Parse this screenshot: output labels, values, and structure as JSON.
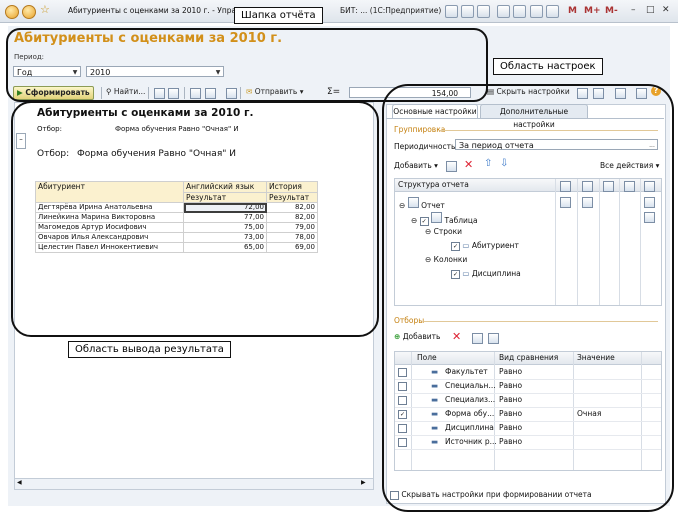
{
  "window": {
    "title": "Абитуриенты с оценками за 2010 г. - Управлен",
    "title_tail": "БИТ: ...  (1С:Предприятие)",
    "menu_m": "M",
    "menu_mplus": "M+",
    "menu_mminus": "M-",
    "min_glyph": "–",
    "max_glyph": "□",
    "close_glyph": "✕"
  },
  "annotations": {
    "header_area": "Шапка отчёта",
    "settings_area": "Область настроек",
    "output_area": "Область вывода результата"
  },
  "form": {
    "title": "Абитуриенты с оценками за 2010 г.",
    "period_label": "Период:",
    "period_type": "Год",
    "period_value": "2010"
  },
  "toolbar": {
    "generate": "Сформировать",
    "find": "Найти...",
    "send": "Отправить",
    "sigma": "Σ=",
    "sum_value": "154,00",
    "hide_settings": "Скрыть настройки"
  },
  "report": {
    "title": "Абитуриенты с оценками за 2010 г.",
    "filter_small_label": "Отбор:",
    "filter_small_value": "Форма обучения Равно \"Очная\" И",
    "filter_big_label": "Отбор:",
    "filter_big_value": "Форма обучения Равно \"Очная\" И",
    "col_applicant": "Абитуриент",
    "col_english": "Английский язык",
    "col_history": "История",
    "col_result": "Результат",
    "rows": [
      {
        "name": "Дегтярёва Ирина Анатольевна",
        "eng": "72,00",
        "hist": "82,00"
      },
      {
        "name": "Линейкина Марина Викторовна",
        "eng": "77,00",
        "hist": "82,00"
      },
      {
        "name": "Магомедов Артур Иосифович",
        "eng": "75,00",
        "hist": "79,00"
      },
      {
        "name": "Овчаров Илья Александрович",
        "eng": "73,00",
        "hist": "78,00"
      },
      {
        "name": "Целестин Павел Иннокентиевич",
        "eng": "65,00",
        "hist": "69,00"
      }
    ]
  },
  "settings": {
    "tab_main": "Основные настройки",
    "tab_extra": "Дополнительные настройки",
    "grouping": "Группировка",
    "periodicity_label": "Периодичность:",
    "periodicity_value": "За период отчета",
    "add": "Добавить",
    "all_actions": "Все действия",
    "structure_header": "Структура отчета",
    "tree": {
      "report": "Отчет",
      "table": "Таблица",
      "rows": "Строки",
      "applicant": "Абитуриент",
      "columns": "Колонки",
      "discipline": "Дисциплина"
    },
    "filters": "Отборы",
    "filters_add": "Добавить",
    "grid_headers": {
      "field": "Поле",
      "comparison": "Вид сравнения",
      "value": "Значение"
    },
    "grid_rows": [
      {
        "checked": false,
        "field": "Факультет",
        "cmp": "Равно",
        "val": ""
      },
      {
        "checked": false,
        "field": "Специальн...",
        "cmp": "Равно",
        "val": ""
      },
      {
        "checked": false,
        "field": "Специализ...",
        "cmp": "Равно",
        "val": ""
      },
      {
        "checked": true,
        "field": "Форма обу...",
        "cmp": "Равно",
        "val": "Очная"
      },
      {
        "checked": false,
        "field": "Дисциплина",
        "cmp": "Равно",
        "val": ""
      },
      {
        "checked": false,
        "field": "Источник р...",
        "cmp": "Равно",
        "val": ""
      }
    ],
    "hide_on_generate": "Скрывать настройки при формировании отчета"
  },
  "colors": {
    "accent": "#d2901a",
    "highlight": "#fbf1cf"
  }
}
